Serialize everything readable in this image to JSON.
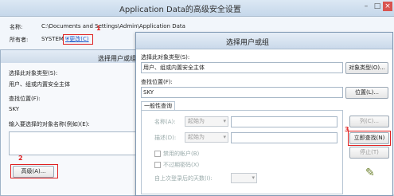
{
  "back_window": {
    "title": "Application Data的高级安全设置",
    "name_label": "名称:",
    "name_value": "C:\\Documents and Settings\\Admin\\Application Data",
    "owner_label": "所有者:",
    "owner_value": "SYSTEM",
    "change_link": "更改(C)"
  },
  "mid_dialog": {
    "title": "选择用户或组",
    "object_type_label": "选择此对象类型(S):",
    "object_type_value": "用户、组或内置安全主体",
    "location_label": "查找位置(F):",
    "location_value": "SKY",
    "names_label": "输入要选择的对象名称(例如)(E):",
    "advanced_button": "高级(A)..."
  },
  "main_dialog": {
    "title": "选择用户或组",
    "object_type_label": "选择此对象类型(S):",
    "object_type_value": "用户、组或内置安全主体",
    "object_type_button": "对象类型(O)...",
    "location_label": "查找位置(F):",
    "location_value": "SKY",
    "location_button": "位置(L)...",
    "tab_label": "一般性查询",
    "name_label": "名称(A):",
    "name_select": "起始为",
    "desc_label": "描述(D):",
    "desc_select": "起始为",
    "disabled_accounts": "禁用的帐户(B)",
    "no_expire_password": "不过期密码(X)",
    "days_since_login": "自上次登录后的天数(I):",
    "columns_button": "列(C)...",
    "find_now_button": "立即查找(N)",
    "stop_button": "停止(T)"
  },
  "annotations": [
    "1",
    "2",
    "3"
  ],
  "colors": {
    "annotation_red": "#e02020",
    "link_blue": "#1a56c8"
  }
}
